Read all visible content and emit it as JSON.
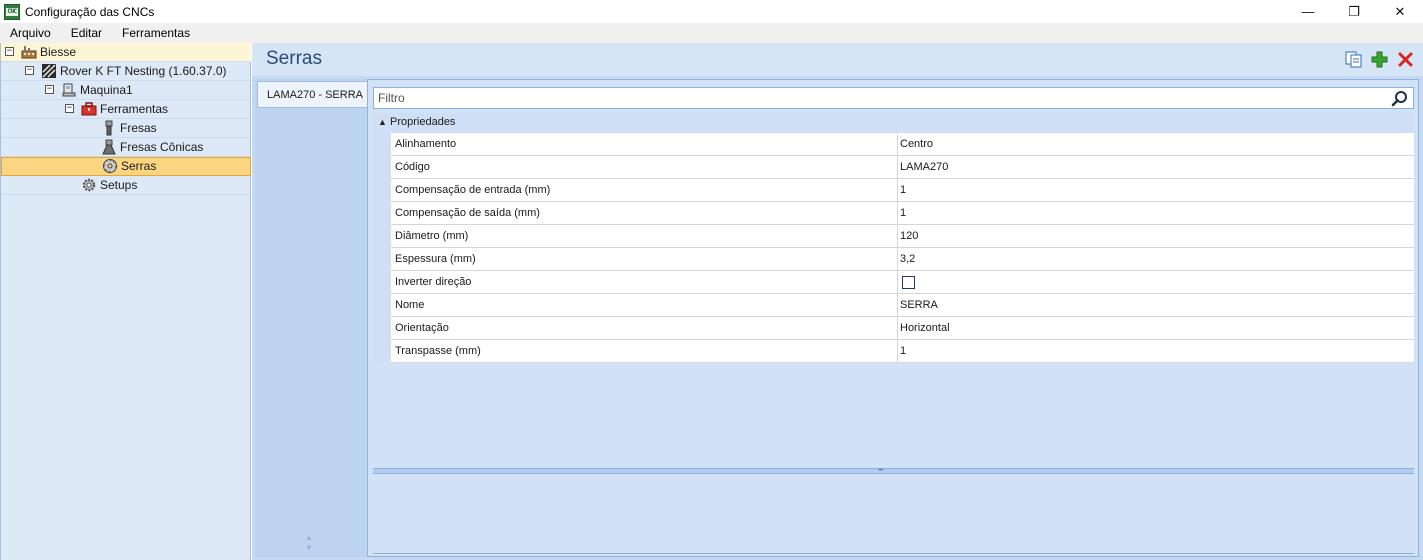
{
  "window": {
    "title": "Configuração das CNCs",
    "icon_text": "CNC"
  },
  "window_controls": {
    "minimize": "—",
    "maximize": "❐",
    "close": "✕"
  },
  "menu": [
    "Arquivo",
    "Editar",
    "Ferramentas"
  ],
  "tree": {
    "root": "Biesse",
    "machine_model": "Rover K FT Nesting (1.60.37.0)",
    "machine": "Maquina1",
    "tools_group": "Ferramentas",
    "tool_fresas": "Fresas",
    "tool_fresas_conicas": "Fresas Cônicas",
    "tool_serras": "Serras",
    "setups": "Setups",
    "expander_symbol": "−"
  },
  "header": {
    "title": "Serras"
  },
  "tabs": [
    {
      "label": "LAMA270 - SERRA"
    }
  ],
  "filter": {
    "placeholder": "Filtro",
    "value": ""
  },
  "properties": {
    "category": "Propriedades",
    "rows": [
      {
        "name": "Alinhamento",
        "value": "Centro"
      },
      {
        "name": "Código",
        "value": "LAMA270"
      },
      {
        "name": "Compensação de entrada (mm)",
        "value": "1"
      },
      {
        "name": "Compensação de saída (mm)",
        "value": "1"
      },
      {
        "name": "Diâmetro (mm)",
        "value": "120"
      },
      {
        "name": "Espessura (mm)",
        "value": "3,2"
      },
      {
        "name": "Inverter direção",
        "value": ""
      },
      {
        "name": "Nome",
        "value": "SERRA"
      },
      {
        "name": "Orientação",
        "value": "Horizontal"
      },
      {
        "name": "Transpasse (mm)",
        "value": "1"
      }
    ],
    "inverter_checked": false
  },
  "colors": {
    "tree_selected": "#fcd581",
    "panel_blue": "#c5daf2",
    "header_title": "#2b4a7a",
    "add_icon": "#3aa52e",
    "delete_icon": "#d9241c"
  },
  "icons": {
    "root": "factory-icon",
    "machine_model": "cnc-machine-icon",
    "machine": "machine-icon",
    "tools_group": "toolbox-icon",
    "fresas": "end-mill-icon",
    "fresas_conicas": "conical-mill-icon",
    "serras": "saw-blade-icon",
    "setups": "gear-icon",
    "copy": "copy-icon",
    "add": "add-icon",
    "delete": "delete-icon",
    "search": "search-icon"
  }
}
